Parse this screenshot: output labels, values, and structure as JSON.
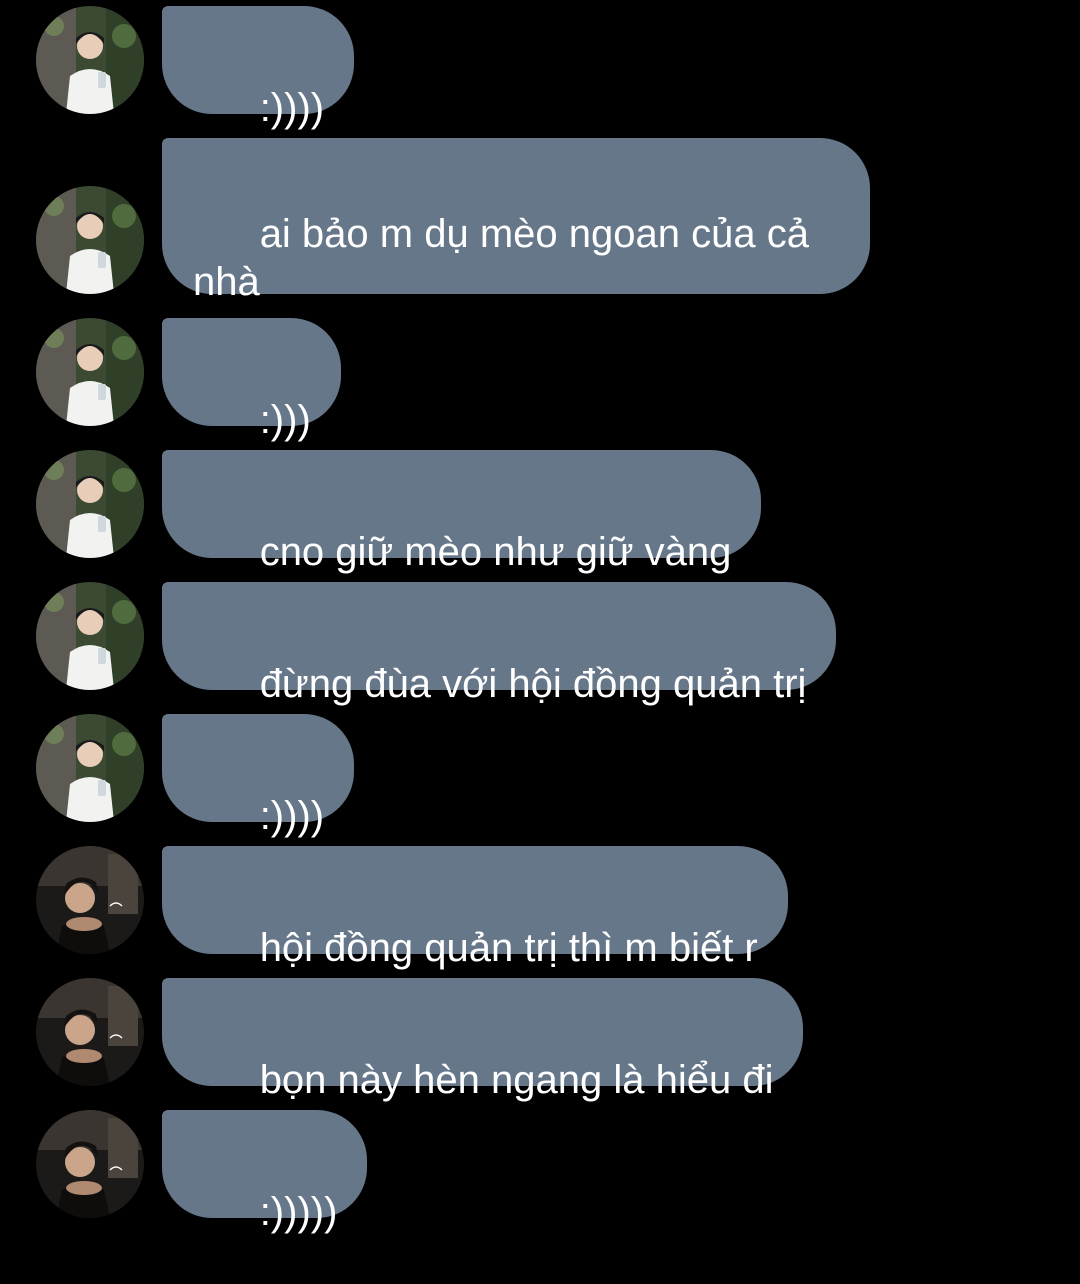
{
  "messages": [
    {
      "sender": "user_a",
      "text": ":))))"
    },
    {
      "sender": "user_a",
      "text": "ai bảo m dụ mèo ngoan của cả nhà"
    },
    {
      "sender": "user_a",
      "text": ":)))"
    },
    {
      "sender": "user_a",
      "text": "cno giữ mèo như giữ vàng"
    },
    {
      "sender": "user_a",
      "text": "đừng đùa với hội đồng quản trị"
    },
    {
      "sender": "user_a",
      "text": ":))))"
    },
    {
      "sender": "user_b",
      "text": "hội đồng quản trị thì m biết r"
    },
    {
      "sender": "user_b",
      "text": "bọn này hèn ngang là hiểu đi"
    },
    {
      "sender": "user_b",
      "text": ":)))))"
    }
  ],
  "colors": {
    "background": "#000000",
    "bubble": "#66778a",
    "bubble_text": "#ffffff"
  }
}
